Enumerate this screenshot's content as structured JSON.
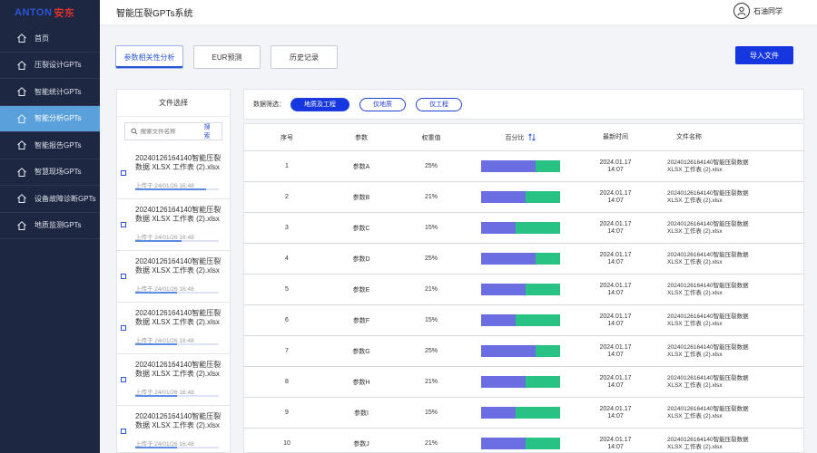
{
  "logo": {
    "part1": "ANTON",
    "part2": "安东"
  },
  "header": {
    "title": "智能压裂GPTs系统",
    "username": "石油同学"
  },
  "sidebar": {
    "items": [
      {
        "label": "首页",
        "icon": "home-icon",
        "active": false
      },
      {
        "label": "压裂设计GPTs",
        "icon": "home-icon",
        "active": false
      },
      {
        "label": "智能统计GPTs",
        "icon": "home-icon",
        "active": false
      },
      {
        "label": "智能分析GPTs",
        "icon": "home-icon",
        "active": true
      },
      {
        "label": "智能报告GPTs",
        "icon": "home-icon",
        "active": false
      },
      {
        "label": "智慧现场GPTs",
        "icon": "home-icon",
        "active": false
      },
      {
        "label": "设备故障诊断GPTs",
        "icon": "home-icon",
        "active": false
      },
      {
        "label": "地质监测GPTs",
        "icon": "home-icon",
        "active": false
      }
    ]
  },
  "tabs": [
    {
      "label": "参数相关性分析",
      "active": true
    },
    {
      "label": "EUR预测",
      "active": false
    },
    {
      "label": "历史记录",
      "active": false
    }
  ],
  "import_button": "导入文件",
  "file_panel": {
    "title": "文件选择",
    "search_placeholder": "搜索文件名称",
    "search_button": "搜索",
    "files": [
      {
        "name": "20240126164140智能压裂数据 XLSX 工作表 (2).xlsx",
        "meta": "上传于 24/01/26 16:48",
        "progress": 0.85
      },
      {
        "name": "20240126164140智能压裂数据 XLSX 工作表 (2).xlsx",
        "meta": "上传于 24/01/26 16:48",
        "progress": 0.55
      },
      {
        "name": "20240126164140智能压裂数据 XLSX 工作表 (2).xlsx",
        "meta": "上传于 24/01/26 16:48",
        "progress": 0.5
      },
      {
        "name": "20240126164140智能压裂数据 XLSX 工作表 (2).xlsx",
        "meta": "上传于 24/01/26 16:48",
        "progress": 0.5
      },
      {
        "name": "20240126164140智能压裂数据 XLSX 工作表 (2).xlsx",
        "meta": "上传于 24/01/26 16:48",
        "progress": 0.5
      },
      {
        "name": "20240126164140智能压裂数据 XLSX 工作表 (2).xlsx",
        "meta": "上传于 24/01/26 16:48",
        "progress": 0.5
      }
    ]
  },
  "filter": {
    "label": "数据筛选：",
    "options": [
      {
        "label": "地质及工程",
        "active": true
      },
      {
        "label": "仅地质",
        "active": false
      },
      {
        "label": "仅工程",
        "active": false
      }
    ]
  },
  "table": {
    "headers": [
      "序号",
      "参数",
      "权重值",
      "百分比",
      "最新时间",
      "文件名称"
    ],
    "rows": [
      {
        "no": "1",
        "param": "参数A",
        "weight": "25%",
        "ratio": 0.7,
        "date": "2024.01.17",
        "time": "14:07",
        "file1": "20240126164140智能压裂数据",
        "file2": "XLSX 工作表 (2).xlsx"
      },
      {
        "no": "2",
        "param": "参数B",
        "weight": "21%",
        "ratio": 0.57,
        "date": "2024.01.17",
        "time": "14:07",
        "file1": "20240126164140智能压裂数据",
        "file2": "XLSX 工作表 (2).xlsx"
      },
      {
        "no": "3",
        "param": "参数C",
        "weight": "15%",
        "ratio": 0.44,
        "date": "2024.01.17",
        "time": "14:07",
        "file1": "20240126164140智能压裂数据",
        "file2": "XLSX 工作表 (2).xlsx"
      },
      {
        "no": "4",
        "param": "参数D",
        "weight": "25%",
        "ratio": 0.7,
        "date": "2024.01.17",
        "time": "14:07",
        "file1": "20240126164140智能压裂数据",
        "file2": "XLSX 工作表 (2).xlsx"
      },
      {
        "no": "5",
        "param": "参数E",
        "weight": "21%",
        "ratio": 0.57,
        "date": "2024.01.17",
        "time": "14:07",
        "file1": "20240126164140智能压裂数据",
        "file2": "XLSX 工作表 (2).xlsx"
      },
      {
        "no": "6",
        "param": "参数F",
        "weight": "15%",
        "ratio": 0.44,
        "date": "2024.01.17",
        "time": "14:07",
        "file1": "20240126164140智能压裂数据",
        "file2": "XLSX 工作表 (2).xlsx"
      },
      {
        "no": "7",
        "param": "参数G",
        "weight": "25%",
        "ratio": 0.7,
        "date": "2024.01.17",
        "time": "14:07",
        "file1": "20240126164140智能压裂数据",
        "file2": "XLSX 工作表 (2).xlsx"
      },
      {
        "no": "8",
        "param": "参数H",
        "weight": "21%",
        "ratio": 0.57,
        "date": "2024.01.17",
        "time": "14:07",
        "file1": "20240126164140智能压裂数据",
        "file2": "XLSX 工作表 (2).xlsx"
      },
      {
        "no": "9",
        "param": "参数I",
        "weight": "15%",
        "ratio": 0.44,
        "date": "2024.01.17",
        "time": "14:07",
        "file1": "20240126164140智能压裂数据",
        "file2": "XLSX 工作表 (2).xlsx"
      },
      {
        "no": "10",
        "param": "参数J",
        "weight": "21%",
        "ratio": 0.57,
        "date": "2024.01.17",
        "time": "14:07",
        "file1": "20240126164140智能压裂数据",
        "file2": "XLSX 工作表 (2).xlsx"
      }
    ]
  },
  "colors": {
    "sidebar_bg": "#1d2741",
    "active_nav": "#5aa0db",
    "primary": "#1637e0",
    "bar_purple": "#6a6ee0",
    "bar_green": "#28c284"
  }
}
